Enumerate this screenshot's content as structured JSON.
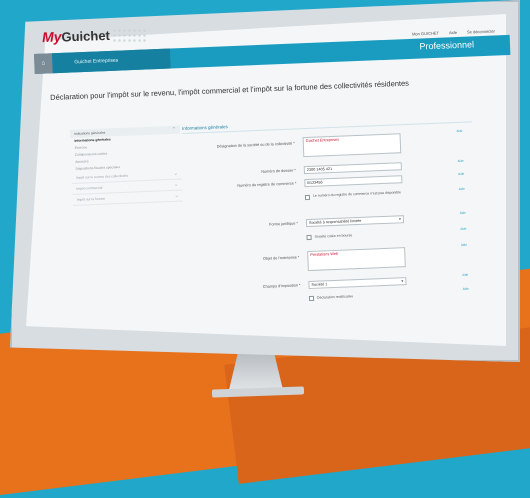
{
  "header": {
    "logo_my": "My",
    "logo_rest": "Guichet",
    "links": [
      "Mon GUICHET",
      "Aide",
      "Se déconnecter"
    ],
    "home_icon": "home-icon",
    "tab": "Guichet Entreprises",
    "section": "Professionnel"
  },
  "page_title": "Déclaration pour l'impôt sur le revenu, l'impôt commercial et l'impôt sur la fortune des collectivités résidentes",
  "sidebar": {
    "head": "Indications générales",
    "active": "Informations générales",
    "items": [
      "Exercice",
      "Collaborateurs cadres",
      "Associés",
      "Dispositions fiscales spéciales"
    ],
    "sections": [
      "Impôt sur le revenu des collectivités",
      "Impôt commercial",
      "Impôt sur la fortune"
    ]
  },
  "form": {
    "section": "Informations générales",
    "aide": "Aide",
    "fields": {
      "denomination": {
        "label": "Désignation de la société ou de la collectivité *",
        "value": "Guichet Entreprises"
      },
      "numero": {
        "label": "Numéro de dossier *",
        "value": "2300 1405 421"
      },
      "rcs": {
        "label": "Numéro du registre de commerce *",
        "value": "B123456"
      },
      "rcs_check": "Le numéro du registre de commerce n'est pas disponible",
      "forme": {
        "label": "Forme juridique *",
        "value": "Société à responsabilité limitée"
      },
      "forme_check": "Société cotée en bourse",
      "objet": {
        "label": "Objet de l'entreprise *",
        "value": "Prestations Web"
      },
      "regime": {
        "label": "Champs d'imposition *",
        "value": "Société 1"
      },
      "regime_check": "Déclaration rectificative"
    }
  }
}
